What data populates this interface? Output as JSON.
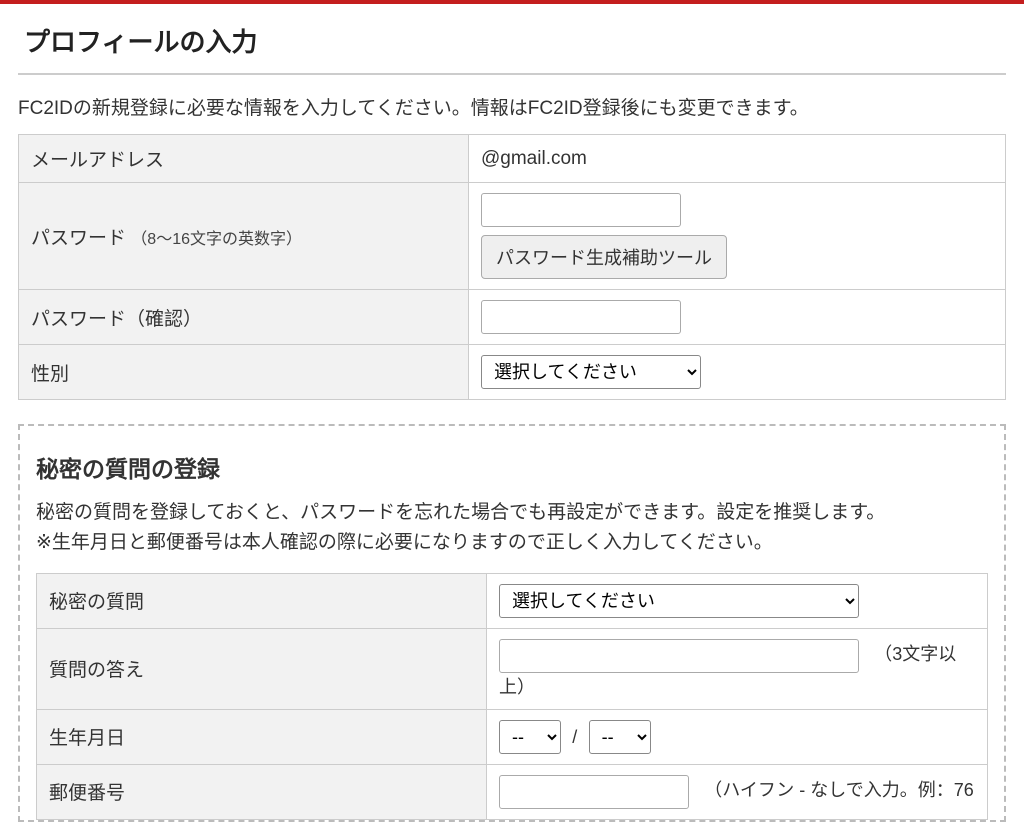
{
  "profile": {
    "title": "プロフィールの入力",
    "intro": "FC2IDの新規登録に必要な情報を入力してください。情報はFC2ID登録後にも変更できます。",
    "rows": {
      "email": {
        "label": "メールアドレス",
        "value": "@gmail.com"
      },
      "password": {
        "label": "パスワード",
        "note": "（8〜16文字の英数字）",
        "tool_button": "パスワード生成補助ツール"
      },
      "password_confirm": {
        "label": "パスワード（確認）"
      },
      "gender": {
        "label": "性別",
        "placeholder": "選択してください"
      }
    }
  },
  "secret": {
    "title": "秘密の質問の登録",
    "desc_line1": "秘密の質問を登録しておくと、パスワードを忘れた場合でも再設定ができます。設定を推奨します。",
    "desc_line2": "※生年月日と郵便番号は本人確認の際に必要になりますので正しく入力してください。",
    "rows": {
      "question": {
        "label": "秘密の質問",
        "placeholder": "選択してください"
      },
      "answer": {
        "label": "質問の答え",
        "hint": "（3文字以上）"
      },
      "birthdate": {
        "label": "生年月日",
        "month_placeholder": "--",
        "day_placeholder": "--",
        "separator": "/"
      },
      "postal": {
        "label": "郵便番号",
        "hint": "（ハイフン - なしで入力。例：76"
      }
    }
  }
}
